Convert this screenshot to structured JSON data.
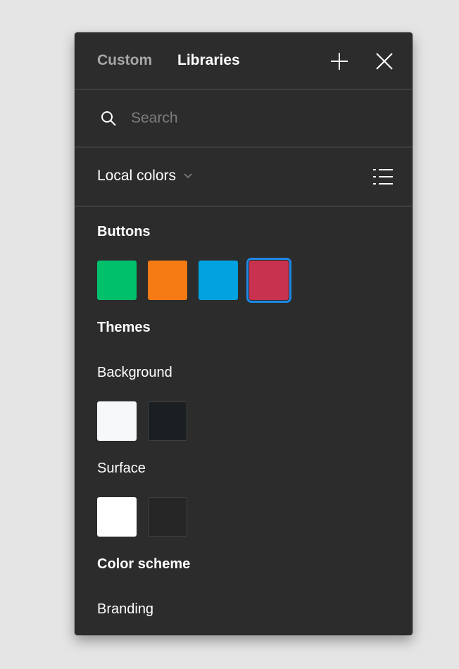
{
  "header": {
    "tabs": [
      {
        "label": "Custom",
        "active": false
      },
      {
        "label": "Libraries",
        "active": true
      }
    ],
    "add_icon": "plus-icon",
    "close_icon": "close-icon"
  },
  "search": {
    "placeholder": "Search",
    "value": ""
  },
  "library_selector": {
    "label": "Local colors",
    "view_toggle_icon": "list-view-icon"
  },
  "groups": [
    {
      "title": "Buttons",
      "style": "bold",
      "swatches": [
        {
          "color": "#00c06b",
          "selected": false
        },
        {
          "color": "#f77b14",
          "selected": false
        },
        {
          "color": "#02a2e0",
          "selected": false
        },
        {
          "color": "#c8324e",
          "selected": true
        }
      ]
    },
    {
      "title": "Themes",
      "style": "bold",
      "swatches": []
    },
    {
      "title": "Background",
      "style": "regular",
      "swatches": [
        {
          "color": "#f7f8fa",
          "selected": false
        },
        {
          "color": "#1c1f21",
          "selected": false
        }
      ]
    },
    {
      "title": "Surface",
      "style": "regular",
      "swatches": [
        {
          "color": "#ffffff",
          "selected": false
        },
        {
          "color": "#262626",
          "selected": false
        }
      ]
    },
    {
      "title": "Color scheme",
      "style": "bold",
      "swatches": []
    },
    {
      "title": "Branding",
      "style": "regular",
      "swatches": []
    }
  ],
  "selection_color": "#1e88e5"
}
